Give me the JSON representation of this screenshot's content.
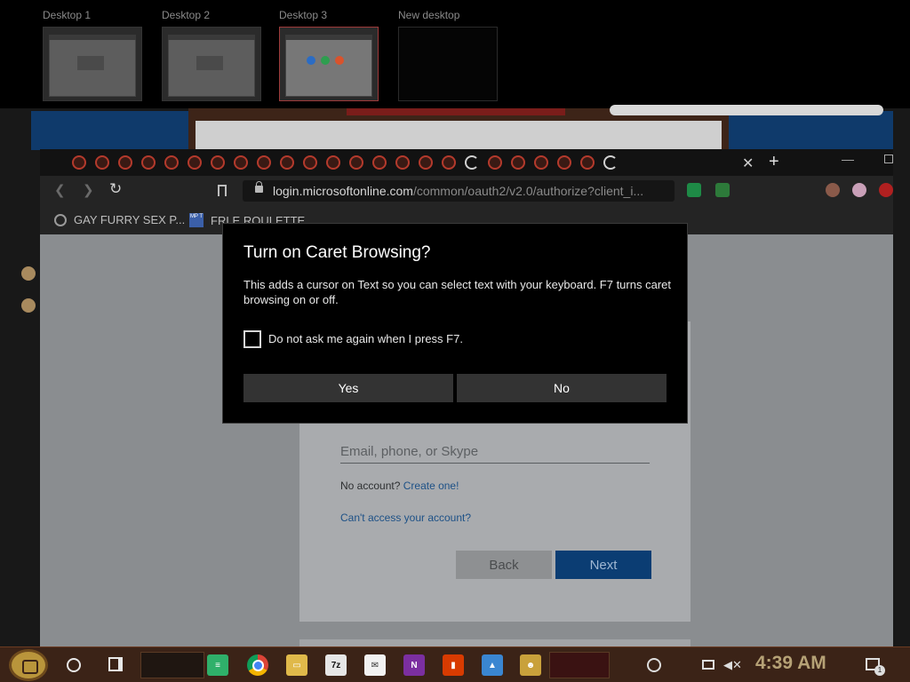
{
  "task_view": {
    "desktops": [
      {
        "label": "Desktop 1"
      },
      {
        "label": "Desktop 2"
      },
      {
        "label": "Desktop 3"
      },
      {
        "label": "New desktop"
      }
    ]
  },
  "browser": {
    "url_host": "login.microsoftonline.com",
    "url_path": "/common/oauth2/v2.0/authorize?client_i...",
    "bookmarks": [
      {
        "label": "GAY FURRY SEX P...",
        "icon": "globe-icon"
      },
      {
        "label": "FRLE ROULETTE",
        "icon": "mp-icon",
        "icon_text": "MP T"
      }
    ]
  },
  "signin": {
    "email_placeholder": "Email, phone, or Skype",
    "no_account_text": "No account?",
    "create_one_link": "Create one!",
    "cant_access_link": "Can't access your account?",
    "back_label": "Back",
    "next_label": "Next"
  },
  "dialog": {
    "title": "Turn on Caret Browsing?",
    "body": "This adds a cursor on Text so you can select text with your keyboard. F7 turns caret browsing on or off.",
    "checkbox_label": "Do not ask me again when I press F7.",
    "yes_label": "Yes",
    "no_label": "No"
  },
  "taskbar": {
    "clock": "4:39 AM",
    "notification_count": "1",
    "apps": [
      {
        "name": "google-chrome-icon"
      },
      {
        "name": "file-explorer-icon"
      },
      {
        "name": "7zip-icon",
        "text": "7z"
      },
      {
        "name": "mail-icon"
      },
      {
        "name": "onenote-icon",
        "text": "N"
      },
      {
        "name": "office-icon"
      },
      {
        "name": "photos-icon"
      },
      {
        "name": "game-icon"
      }
    ]
  },
  "colors": {
    "dialog_bg": "#000000",
    "dialog_button": "#333333",
    "next_button": "#0b3d73",
    "taskbar": "#3b2317",
    "clock": "#b6a276"
  }
}
